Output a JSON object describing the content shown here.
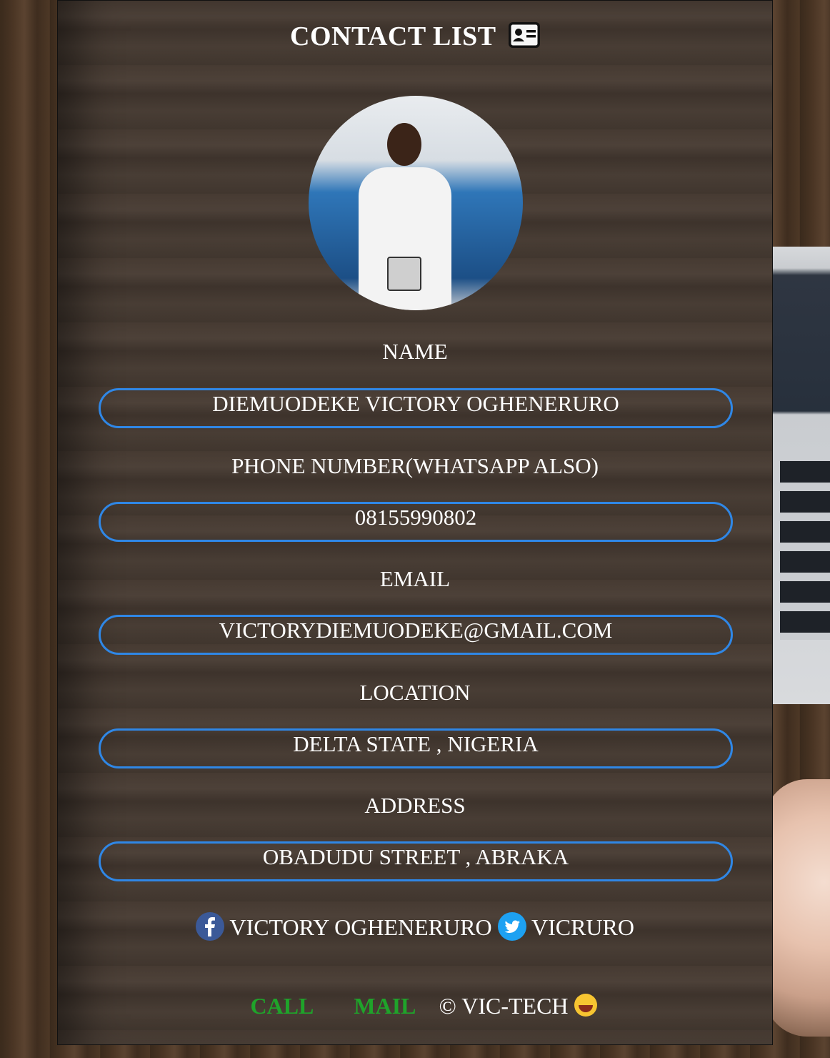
{
  "header": {
    "title": "CONTACT LIST",
    "icon": "id-card-icon"
  },
  "profile": {
    "photo": "profile-photo"
  },
  "fields": [
    {
      "label": "NAME",
      "value": "DIEMUODEKE VICTORY OGHENERURO"
    },
    {
      "label": "PHONE NUMBER(WHATSAPP ALSO)",
      "value": "08155990802"
    },
    {
      "label": "EMAIL",
      "value": "VICTORYDIEMUODEKE@GMAIL.COM"
    },
    {
      "label": "LOCATION",
      "value": "DELTA STATE , NIGERIA"
    },
    {
      "label": "ADDRESS",
      "value": "OBADUDU STREET , ABRAKA"
    }
  ],
  "social": {
    "facebook": {
      "icon": "facebook-icon",
      "text": "VICTORY OGHENERURO"
    },
    "twitter": {
      "icon": "twitter-icon",
      "text": "VICRURO"
    }
  },
  "footer": {
    "call_label": "CALL",
    "mail_label": "MAIL",
    "copyright": "© VIC-TECH",
    "emoji": "grinning-face-icon"
  },
  "colors": {
    "accent": "#2f87e6",
    "link": "#1fa32a",
    "text": "#ffffff"
  }
}
